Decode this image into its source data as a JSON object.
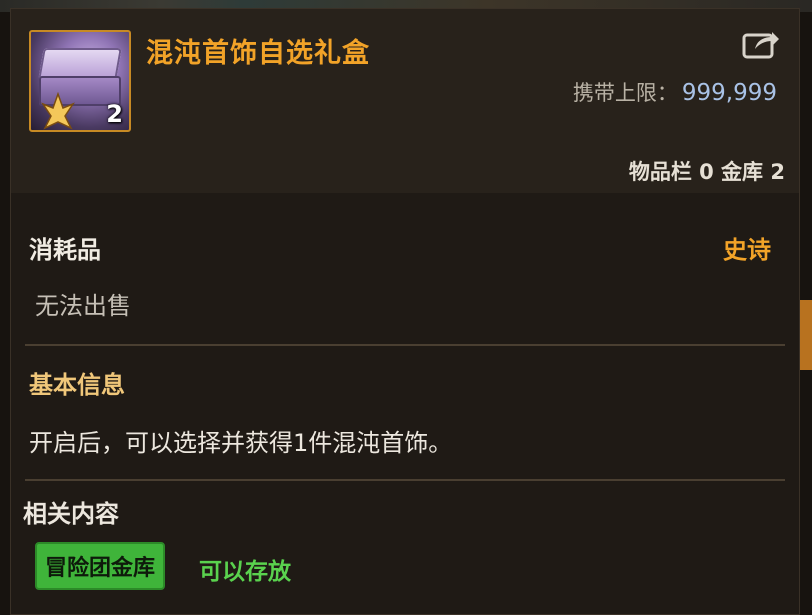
{
  "item": {
    "name": "混沌首饰自选礼盒",
    "stack_count": "2",
    "carry_limit_label": "携带上限：",
    "carry_limit_value": "999,999",
    "storage_text": "物品栏 0 金库 2"
  },
  "info": {
    "category": "消耗品",
    "rarity": "史诗",
    "sell_status": "无法出售",
    "basic_title": "基本信息",
    "basic_desc": "开启后，可以选择并获得1件混沌首饰。",
    "related_title": "相关内容",
    "related_badge": "冒险团金库",
    "related_status": "可以存放"
  },
  "icons": {
    "share": "share-icon",
    "item": "gift-box-icon"
  },
  "colors": {
    "name_gold": "#f2a328",
    "rarity_epic": "#f2a328",
    "badge_green": "#3fb43a",
    "status_green": "#5ad24e",
    "limit_blue": "#a9c2e6"
  }
}
